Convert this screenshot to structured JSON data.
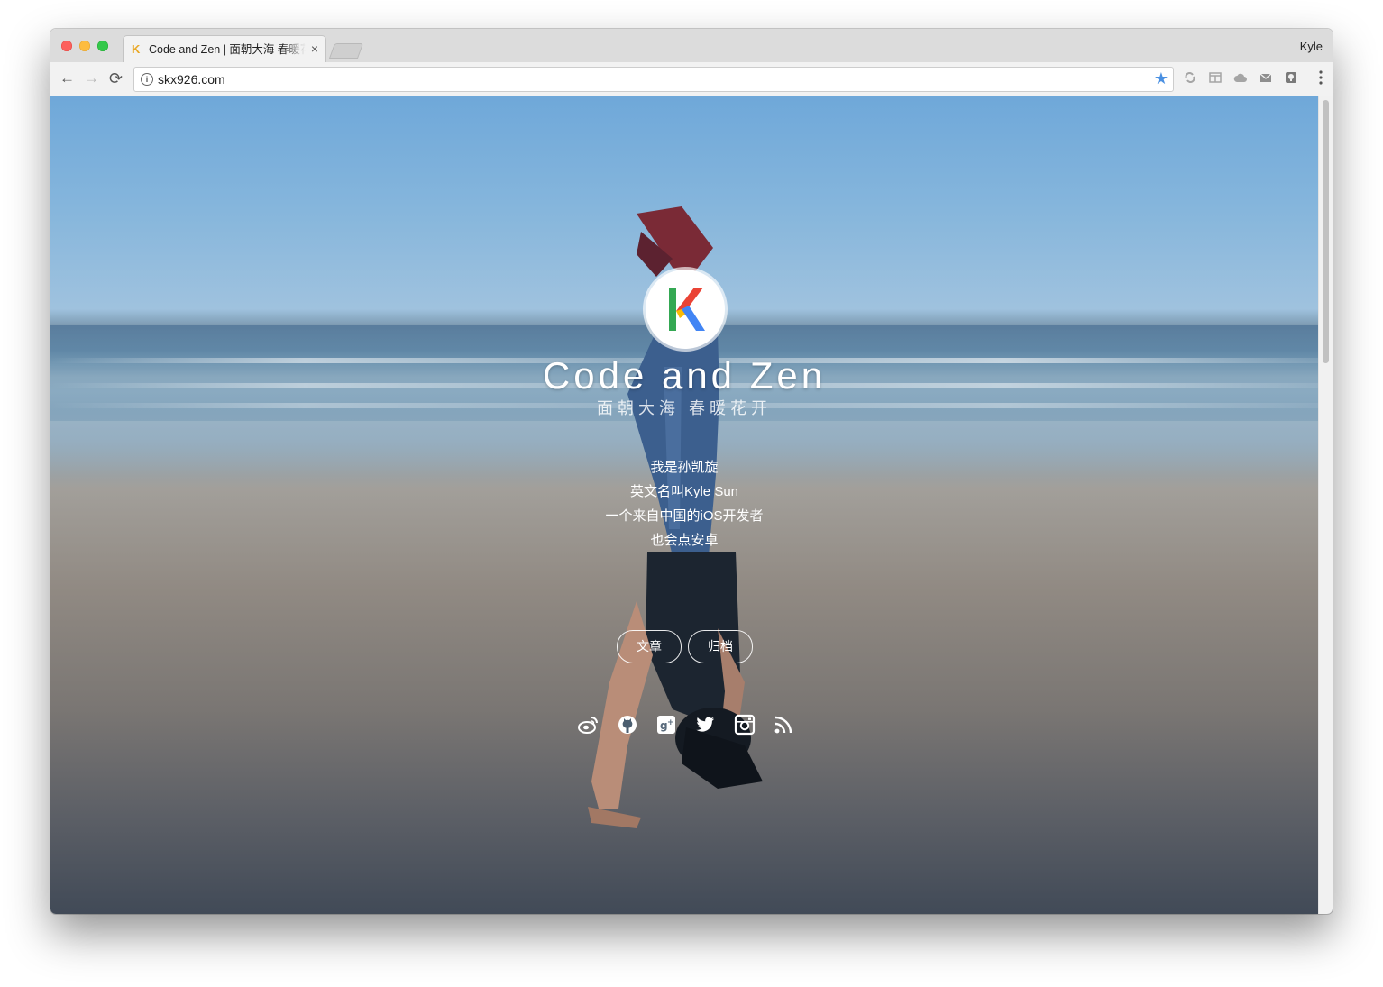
{
  "browser": {
    "tab": {
      "favicon": "K",
      "title": "Code and Zen | 面朝大海 春暖花开",
      "close_label": "×"
    },
    "profile": "Kyle",
    "nav": {
      "back": "←",
      "forward": "→",
      "reload": "⟳"
    },
    "url": "skx926.com",
    "info_icon": "i",
    "bookmark_star": "★",
    "menu": "⋮"
  },
  "site": {
    "logo_letter": "K",
    "title": "Code and Zen",
    "subtitle": "面朝大海 春暖花开",
    "bio": [
      "我是孙凯旋",
      "英文名叫Kyle Sun",
      "一个来自中国的iOS开发者",
      "也会点安卓"
    ],
    "buttons": {
      "posts": "文章",
      "archive": "归档"
    },
    "social_icons": [
      "weibo-icon",
      "github-icon",
      "google-plus-icon",
      "twitter-icon",
      "instagram-icon",
      "rss-icon"
    ]
  },
  "colors": {
    "logo_green": "#34a853",
    "logo_red": "#ea4335",
    "logo_yellow": "#fbbc05",
    "logo_blue": "#4285f4",
    "bookmark_star": "#4a90e2"
  }
}
